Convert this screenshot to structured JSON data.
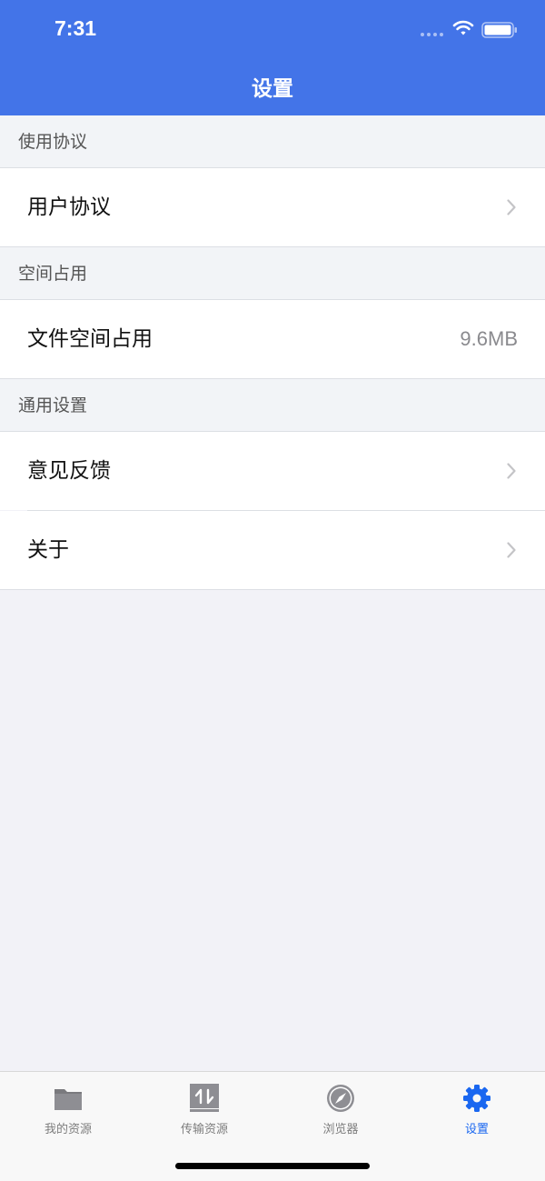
{
  "status_bar": {
    "time": "7:31"
  },
  "nav": {
    "title": "设置"
  },
  "sections": [
    {
      "header": "使用协议",
      "items": [
        {
          "label": "用户协议"
        }
      ]
    },
    {
      "header": "空间占用",
      "items": [
        {
          "label": "文件空间占用",
          "value": "9.6MB"
        }
      ]
    },
    {
      "header": "通用设置",
      "items": [
        {
          "label": "意见反馈"
        },
        {
          "label": "关于"
        }
      ]
    }
  ],
  "tabbar": {
    "tabs": [
      {
        "label": "我的资源",
        "icon": "folder-icon"
      },
      {
        "label": "传输资源",
        "icon": "transfer-icon"
      },
      {
        "label": "浏览器",
        "icon": "compass-icon"
      },
      {
        "label": "设置",
        "icon": "gear-icon",
        "active": true
      }
    ]
  },
  "colors": {
    "accent": "#4374e8",
    "tab_active": "#1a67f0",
    "background": "#f2f2f7"
  }
}
